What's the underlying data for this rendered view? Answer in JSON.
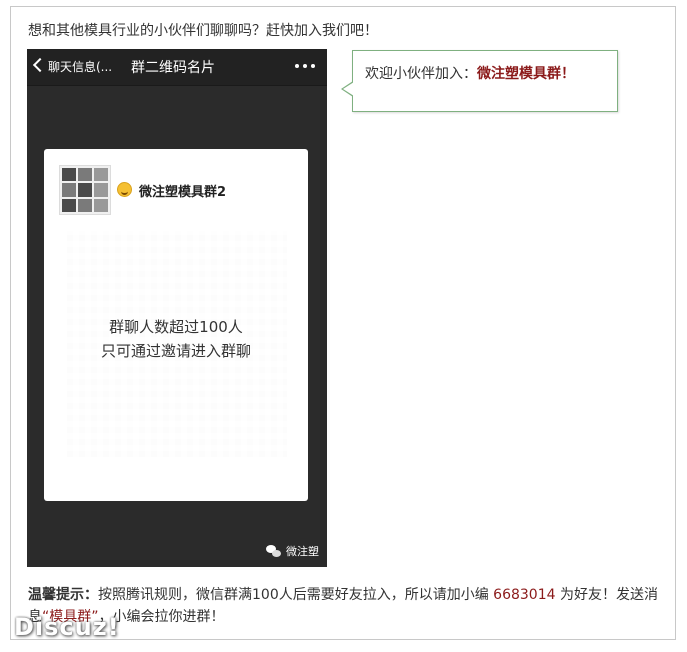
{
  "intro_text": "想和其他模具行业的小伙伴们聊聊吗？赶快加入我们吧！",
  "phone": {
    "back_label": "聊天信息(...",
    "title": "群二维码名片",
    "group_name": "微注塑模具群2",
    "qr_message_line1": "群聊人数超过100人",
    "qr_message_line2": "只可通过邀请进入群聊",
    "watermark": "微注塑",
    "icons": [
      "back-chevron",
      "more-dots",
      "group-avatar",
      "grin-emoji",
      "wechat-logo"
    ]
  },
  "bubble": {
    "prefix": "欢迎小伙伴加入：",
    "highlight": "微注塑模具群！",
    "border_color": "#7fb080",
    "highlight_color": "#8b1a1a"
  },
  "tip": {
    "label": "温馨提示：",
    "text1": "按照腾讯规则，微信群满100人后需要好友拉入，所以请加小编 ",
    "number": "6683014",
    "text2": " 为好友！发送消息",
    "keyword": "“模具群”",
    "text3": "，小编会拉你进群！"
  },
  "logo": "Discuz!"
}
